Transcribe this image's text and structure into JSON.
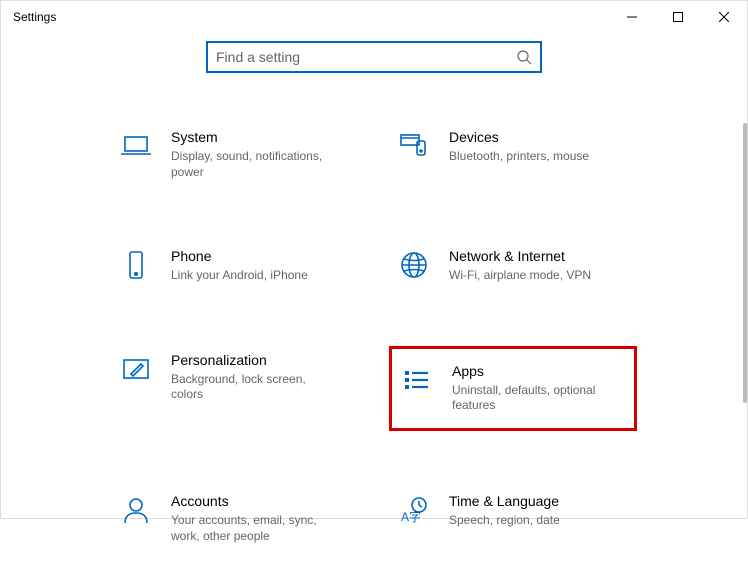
{
  "window": {
    "title": "Settings"
  },
  "search": {
    "placeholder": "Find a setting"
  },
  "categories": [
    {
      "id": "system",
      "title": "System",
      "desc": "Display, sound, notifications, power"
    },
    {
      "id": "devices",
      "title": "Devices",
      "desc": "Bluetooth, printers, mouse"
    },
    {
      "id": "phone",
      "title": "Phone",
      "desc": "Link your Android, iPhone"
    },
    {
      "id": "network",
      "title": "Network & Internet",
      "desc": "Wi-Fi, airplane mode, VPN"
    },
    {
      "id": "personalization",
      "title": "Personalization",
      "desc": "Background, lock screen, colors"
    },
    {
      "id": "apps",
      "title": "Apps",
      "desc": "Uninstall, defaults, optional features",
      "highlighted": true
    },
    {
      "id": "accounts",
      "title": "Accounts",
      "desc": "Your accounts, email, sync, work, other people"
    },
    {
      "id": "time",
      "title": "Time & Language",
      "desc": "Speech, region, date"
    }
  ],
  "colors": {
    "accent": "#0067c0",
    "highlight_border": "#d40000"
  }
}
